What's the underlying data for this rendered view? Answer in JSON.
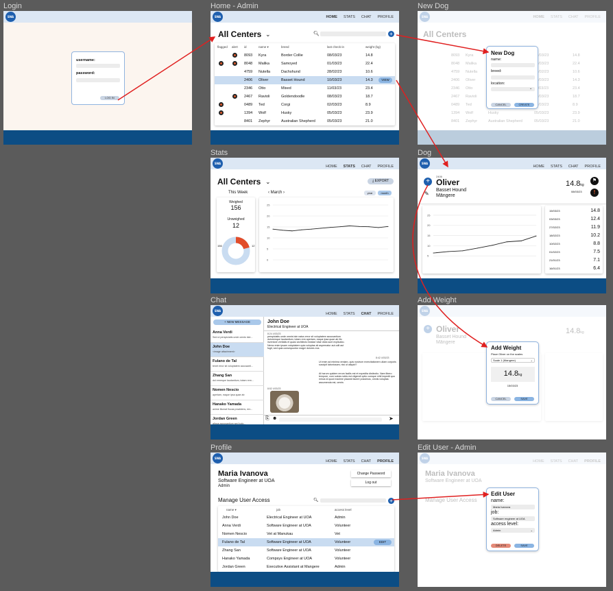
{
  "frames": {
    "login": "Login",
    "home": "Home - Admin",
    "new_dog": "New Dog",
    "stats": "Stats",
    "dog": "Dog",
    "chat": "Chat",
    "add_weight": "Add Weight",
    "profile": "Profile",
    "edit_user": "Edit User - Admin"
  },
  "logo_text": "SNA",
  "nav": {
    "home": "HOME",
    "stats": "STATS",
    "chat": "CHAT",
    "profile": "PROFILE"
  },
  "login": {
    "username_label": "username:",
    "password_label": "password:",
    "login_button": "LOG IN"
  },
  "home": {
    "title": "All Centers",
    "columns": {
      "flagged": "flagged",
      "alert": "alert",
      "id": "id",
      "name": "name ▾",
      "breed": "breed",
      "last_checkin": "last check-in",
      "weight": "weight (kg)"
    },
    "view_button": "VIEW",
    "rows": [
      {
        "id": "8093",
        "name": "Kyra",
        "breed": "Border Collie",
        "date": "08/03/23",
        "weight": "14.8"
      },
      {
        "id": "8048",
        "name": "Malika",
        "breed": "Samoyed",
        "date": "01/03/23",
        "weight": "22.4"
      },
      {
        "id": "4759",
        "name": "Nutella",
        "breed": "Dachshund",
        "date": "28/02/23",
        "weight": "10.6"
      },
      {
        "id": "2406",
        "name": "Oliver",
        "breed": "Basset Hound",
        "date": "10/03/23",
        "weight": "14.3"
      },
      {
        "id": "2346",
        "name": "Otto",
        "breed": "Mixed",
        "date": "11/03/23",
        "weight": "23.4"
      },
      {
        "id": "2467",
        "name": "Ravioli",
        "breed": "Goldendoodle",
        "date": "08/03/23",
        "weight": "18.7"
      },
      {
        "id": "0489",
        "name": "Ted",
        "breed": "Corgi",
        "date": "02/03/23",
        "weight": "8.9"
      },
      {
        "id": "1394",
        "name": "Wolf",
        "breed": "Husky",
        "date": "05/03/23",
        "weight": "23.9"
      },
      {
        "id": "8401",
        "name": "Zephyr",
        "breed": "Australian Shepherd",
        "date": "05/03/23",
        "weight": "21.0"
      }
    ]
  },
  "new_dog": {
    "title": "New Dog",
    "name_label": "name:",
    "breed_label": "breed:",
    "location_label": "location:",
    "cancel": "CANCEL",
    "create": "CREATE"
  },
  "stats": {
    "title": "All Centers",
    "export": "EXPORT",
    "this_week": "This Week",
    "month": "March",
    "toggle_year": "year",
    "toggle_month": "month",
    "weighed_label": "Weighed",
    "weighed": "156",
    "unweighed_label": "Unweighed",
    "unweighed": "12",
    "donut_left": "156",
    "donut_right": "12"
  },
  "dog": {
    "id_small": "2406",
    "name": "Oliver",
    "breed": "Basset Hound",
    "location": "Māngere",
    "weight": "14.8",
    "unit": "kg",
    "date": "08/03/23",
    "history": [
      {
        "date": "15/03/23",
        "w": "14.8"
      },
      {
        "date": "03/03/23",
        "w": "12.4"
      },
      {
        "date": "27/02/23",
        "w": "11.9"
      },
      {
        "date": "18/02/23",
        "w": "10.2"
      },
      {
        "date": "10/02/23",
        "w": "8.8"
      },
      {
        "date": "01/02/23",
        "w": "7.5"
      },
      {
        "date": "21/01/23",
        "w": "7.1"
      },
      {
        "date": "16/01/23",
        "w": "6.4"
      }
    ]
  },
  "chart_data": [
    {
      "type": "line",
      "y_ticks": [
        "25",
        "20",
        "15",
        "10",
        "5",
        "0"
      ],
      "ylim": [
        0,
        25
      ],
      "values": [
        14,
        13.5,
        13.2,
        13.7,
        14,
        14.4,
        14.8,
        15.1,
        15.5,
        15.2,
        15.1,
        14.7,
        15.2
      ]
    },
    {
      "type": "line",
      "y_ticks": [
        "25",
        "20",
        "15",
        "10",
        "5"
      ],
      "ylim": [
        0,
        27
      ],
      "values": [
        6.4,
        7.1,
        7.5,
        8.8,
        10.2,
        11.9,
        12.4,
        14.8
      ]
    }
  ],
  "chat": {
    "new_message": "NEW MESSAGE",
    "contacts": [
      {
        "name": "Anna Verdi",
        "preview": "Sed ut perspiciatis unde omnis iste..."
      },
      {
        "name": "John Doe",
        "preview": "<image attachment>"
      },
      {
        "name": "Fulano de Tal",
        "preview": "tenet error sit voluptatem accusanti..."
      },
      {
        "name": "Zhang San",
        "preview": "dol ermeque laudantium, totam rem..."
      },
      {
        "name": "Nomen Nescio",
        "preview": "aperiam, eaque ipsa quae ab"
      },
      {
        "name": "Hanako Yamada",
        "preview": "anime illumat flucas pravidens, ern..."
      },
      {
        "name": "Jordan Green",
        "preview": "aliqua accusantium sed iudo..."
      }
    ],
    "active_name": "John Doe",
    "active_job": "Electrical Engineer at UOA",
    "m1_time": "8:24 4/03/23",
    "m1": "perspiciatis unde omnis iste natus error sit voluptatem accusantium doloremque laudantium, totam rem aperiam, eaque ipsa quae ab illo inventore veritatis et quasi architecto beatae vitae dicta sunt explicabo. Nemo enim ipsam voluptatem quia voluptas sit aspernatur aut odit aut fugit, sed quia consequuntur magni dolores eos",
    "m2_time": "8:42 4/03/23",
    "m2": "Ut enim ad minima veniam, quis nostrum exercitationem ullam corporis suscipit laboriosam, nisi ut aliquid?",
    "m3": "At harum quidem rerum facilis est et expedita distinctio. Nam libero tempore, cum soluta nobis est eligendi optio cumque nihil impedit quo minus id quod maxime placeat facere possimus, omnis voluptas assumenda est, omnis",
    "m4_time": "8:52 4/03/23"
  },
  "add_weight": {
    "title": "Add Weight",
    "instruction": "Place Oliver on the scales",
    "scale": "Scale 1 (Mangere)",
    "weight": "14.8",
    "unit": "kg",
    "date": "15/03/23",
    "cancel": "CANCEL",
    "save": "SAVE"
  },
  "profile": {
    "name": "Maria Ivanova",
    "job": "Software Engineer at UOA",
    "role": "Admin",
    "change_password": "Change Password",
    "logout": "Log out",
    "manage": "Manage User Access",
    "columns": {
      "name": "name ▾",
      "job": "job",
      "access": "access level"
    },
    "edit": "EDIT",
    "users": [
      {
        "name": "John Doe",
        "job": "Electrical Engineer at UOA",
        "access": "Admin"
      },
      {
        "name": "Anna Verdi",
        "job": "Software Engineer at UOA",
        "access": "Volunteer"
      },
      {
        "name": "Nomen Nescio",
        "job": "Vet at Manukau",
        "access": "Vet"
      },
      {
        "name": "Fulano de Tal",
        "job": "Software Engineer at UOA",
        "access": "Volunteer"
      },
      {
        "name": "Zhang San",
        "job": "Software Engineer at UOA",
        "access": "Volunteer"
      },
      {
        "name": "Hanako Yamada",
        "job": "Compsys Engineer at UOA",
        "access": "Volunteer"
      },
      {
        "name": "Jordan Green",
        "job": "Executive Assistant at Mangere",
        "access": "Admin"
      }
    ]
  },
  "edit_user": {
    "title": "Edit User",
    "name_label": "name:",
    "name": "Maria Ivanova",
    "job_label": "job:",
    "job": "Software engineer at UOA",
    "access_label": "access level:",
    "access": "Admin",
    "delete": "DELETE",
    "save": "SAVE"
  },
  "colors": {
    "accent": "#1e5fae",
    "footer": "#0c4d84",
    "header": "#dce7f4",
    "arrow": "#e02020",
    "highlight": "#c9dcf1"
  }
}
